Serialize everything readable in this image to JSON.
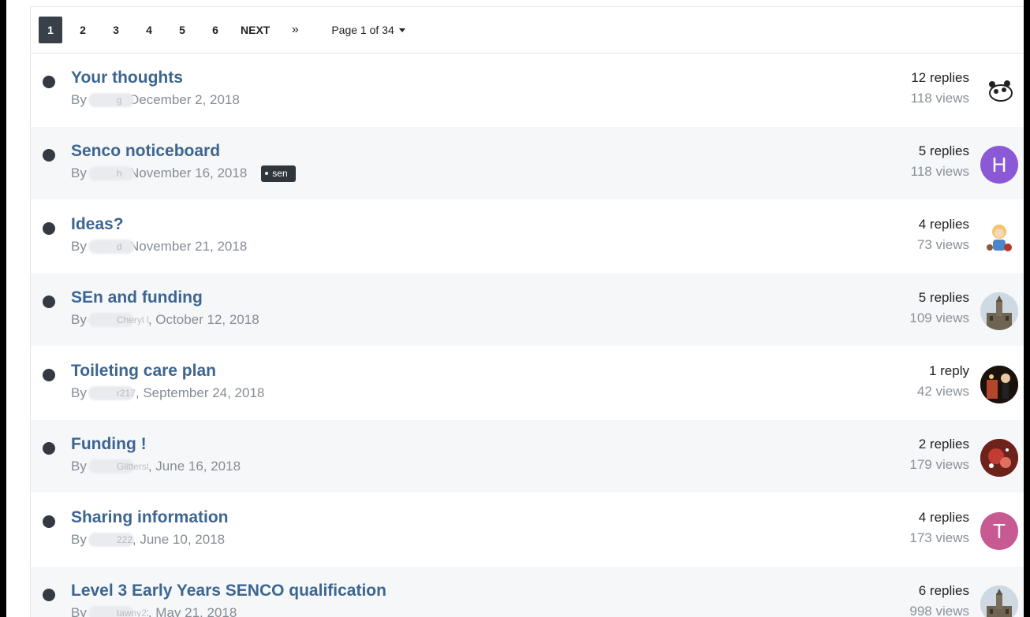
{
  "pagination": {
    "pages": [
      "1",
      "2",
      "3",
      "4",
      "5",
      "6"
    ],
    "active": "1",
    "next_label": "NEXT",
    "last_label": "»",
    "page_info": "Page 1 of 34"
  },
  "topics": [
    {
      "title": "Your thoughts",
      "author_prefix": "By",
      "author_visible": "g",
      "date": ", December 2, 2018",
      "replies": "12 replies",
      "views": "118 views",
      "avatar": {
        "type": "image",
        "icon": "panda-avatar",
        "bg": "#ffffff"
      }
    },
    {
      "title": "Senco noticeboard",
      "author_prefix": "By",
      "author_visible": "h",
      "date": ", November 16, 2018",
      "tag": "sen",
      "replies": "5 replies",
      "views": "118 views",
      "avatar": {
        "type": "letter",
        "letter": "H",
        "bg": "#8b59d6"
      }
    },
    {
      "title": "Ideas?",
      "author_prefix": "By",
      "author_visible": "d",
      "date": ", November 21, 2018",
      "replies": "4 replies",
      "views": "73 views",
      "avatar": {
        "type": "image",
        "icon": "cartoon-girl-avatar",
        "bg": "#ffffff"
      }
    },
    {
      "title": "SEn and funding",
      "author_prefix": "By",
      "author_visible": "Cheryl Herrick",
      "date": ", October 12, 2018",
      "replies": "5 replies",
      "views": "109 views",
      "avatar": {
        "type": "image",
        "icon": "building-avatar",
        "bg": "#c9d4dc"
      }
    },
    {
      "title": "Toileting care plan",
      "author_prefix": "By",
      "author_visible": "r217",
      "date": ", September 24, 2018",
      "replies": "1 reply",
      "views": "42 views",
      "avatar": {
        "type": "image",
        "icon": "dark-photo-avatar",
        "bg": "#2a1a12"
      }
    },
    {
      "title": "Funding !",
      "author_prefix": "By",
      "author_visible": "Glitterstar",
      "date": ", June 16, 2018",
      "replies": "2 replies",
      "views": "179 views",
      "avatar": {
        "type": "image",
        "icon": "red-photo-avatar",
        "bg": "#7a2b24"
      }
    },
    {
      "title": "Sharing information",
      "author_prefix": "By",
      "author_visible": "222",
      "date": ", June 10, 2018",
      "replies": "4 replies",
      "views": "173 views",
      "avatar": {
        "type": "letter",
        "letter": "T",
        "bg": "#c75a92"
      }
    },
    {
      "title": "Level 3 Early Years SENCO qualification",
      "author_prefix": "By",
      "author_visible": "tawny222",
      "date": ", May 21, 2018",
      "replies": "6 replies",
      "views": "998 views",
      "avatar": {
        "type": "image",
        "icon": "building-avatar",
        "bg": "#c9d4dc"
      }
    }
  ]
}
